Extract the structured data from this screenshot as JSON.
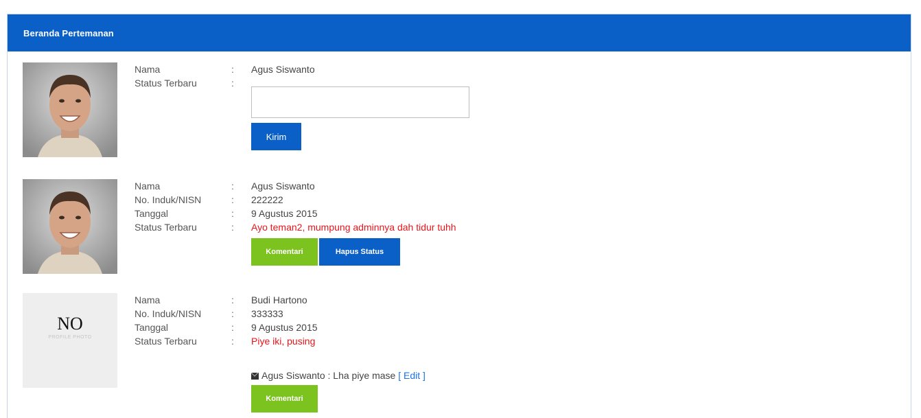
{
  "panel": {
    "title": "Beranda Pertemanan"
  },
  "composer": {
    "name_label": "Nama",
    "name_value": "Agus Siswanto",
    "status_label": "Status Terbaru",
    "status_input_value": "",
    "send_label": "Kirim",
    "separator": ":"
  },
  "posts": [
    {
      "name_label": "Nama",
      "name_value": "Agus Siswanto",
      "nisn_label": "No. Induk/NISN",
      "nisn_value": "222222",
      "date_label": "Tanggal",
      "date_value": "9 Agustus 2015",
      "status_label": "Status Terbaru",
      "status_value": "Ayo teman2, mumpung adminnya dah tidur tuhh",
      "comment_label": "Komentari",
      "delete_label": "Hapus Status",
      "separator": ":"
    },
    {
      "name_label": "Nama",
      "name_value": "Budi Hartono",
      "nisn_label": "No. Induk/NISN",
      "nisn_value": "333333",
      "date_label": "Tanggal",
      "date_value": "9 Agustus 2015",
      "status_label": "Status Terbaru",
      "status_value": "Piye iki, pusing",
      "no_photo_title": "NO",
      "no_photo_sub": "PROFILE PHOTO",
      "reply_author": "Agus Siswanto",
      "reply_text": ": Lha piye mase",
      "reply_edit_label": "[ Edit ]",
      "comment_label": "Komentari",
      "separator": ":"
    }
  ],
  "colors": {
    "primary": "#0b60c8",
    "accent_green": "#7cc31f",
    "status_red": "#e8141b"
  }
}
